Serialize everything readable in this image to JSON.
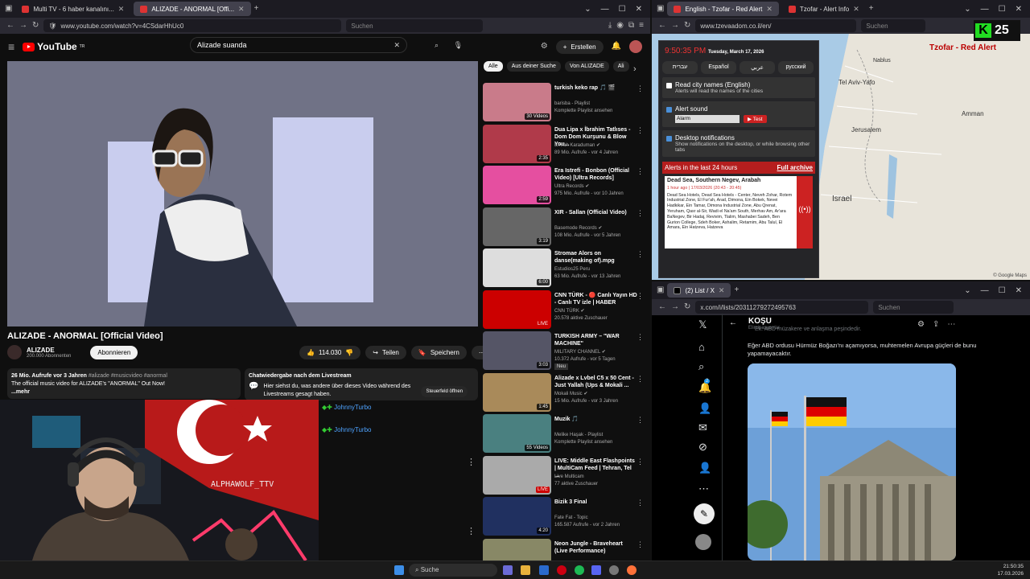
{
  "yt_window": {
    "tabs": [
      {
        "label": "Multi TV - 6 haber kanalını..."
      },
      {
        "label": "ALIZADE - ANORMAL [Offi..."
      }
    ],
    "url": "www.youtube.com/watch?v=4CSdarHhUc0",
    "search_ph": "Suchen",
    "logo": "YouTube",
    "logo_sup": "TR",
    "search_query": "Alizade suanda",
    "create_label": "Erstellen",
    "video_title": "ALIZADE - ANORMAL [Official Video]",
    "channel": "ALIZADE",
    "subs": "200.000 Abonnenten",
    "subscribe": "Abonnieren",
    "likes": "114.030",
    "share": "Teilen",
    "save": "Speichern",
    "desc_meta": "26 Mio. Aufrufe  vor 3 Jahren",
    "desc_tags": " #alizade #musicvideo #anormal",
    "desc_text": "The official music video for ALIZADE's \"ANORMAL\" Out Now!",
    "desc_more": "...mehr",
    "chat_title": "Chatwiedergabe nach dem Livestream",
    "chat_text": "Hier siehst du, was andere über dieses Video während des Livestreams gesagt haben.",
    "chat_btn": "Steuerfeld öffnen",
    "chips": [
      "Alle",
      "Aus deiner Suche",
      "Von ALIZADE",
      "Ali"
    ],
    "recs": [
      {
        "title": "turkish keko rap 🎵 🎬",
        "s1": "barisba - Playlist",
        "s2": "Komplette Playlist ansehen",
        "dur": "30 Videos",
        "col": "#c97b8a"
      },
      {
        "title": "Dua Lipa x İbrahim Tatlıses - Dom Dom Kurşunu & Blow You...",
        "s1": "Emrah Karaduman ✔",
        "s2": "89 Mio. Aufrufe - vor 4 Jahren",
        "dur": "2:35",
        "col": "#b03a4a"
      },
      {
        "title": "Era Istrefi - Bonbon (Official Video) [Ultra Records]",
        "s1": "Ultra Records ✔",
        "s2": "975 Mio. Aufrufe - vor 10 Jahren",
        "dur": "2:59",
        "col": "#e54fa0"
      },
      {
        "title": "XIR - Sallan (Official Video)",
        "s1": "Basemode Records ✔",
        "s2": "108 Mio. Aufrufe - vor 5 Jahren",
        "dur": "3:19",
        "col": "#666"
      },
      {
        "title": "Stromae  Alors on danse(making of).mpg",
        "s1": "Estudios25 Peru",
        "s2": "63 Mio. Aufrufe - vor 13 Jahren",
        "dur": "6:00",
        "col": "#ddd"
      },
      {
        "title": "CNN TÜRK - 🔴 Canlı Yayın HD - Canlı TV izle | HABER",
        "s1": "CNN TÜRK ✔",
        "s2": "20.578 aktive Zuschauer",
        "dur": "LIVE",
        "col": "#c00"
      },
      {
        "title": "TURKISH ARMY – \"WAR MACHINE\"",
        "s1": "MILITARY CHANNEL ✔",
        "s2": "10.372 Aufrufe - vor 5 Tagen",
        "dur": "3:03",
        "col": "#556",
        "badge": "Neu"
      },
      {
        "title": "Alizade x Lvbel C5 x 50 Cent - Just Yallah (Ups & Mokali ...",
        "s1": "Mokali Music ✔",
        "s2": "15 Mio. Aufrufe - vor 3 Jahren",
        "dur": "1:45",
        "col": "#a98a5a"
      },
      {
        "title": "Muzik 🎵",
        "s1": "Melike Haşak - Playlist",
        "s2": "Komplette Playlist ansehen",
        "dur": "55 Videos",
        "col": "#4a8080"
      },
      {
        "title": "LIVE: Middle East Flashpoints | MultiCam Feed | Tehran, Tel ...",
        "s1": "Live Multicam",
        "s2": "77 aktive Zuschauer",
        "dur": "LIVE",
        "col": "#aaa"
      },
      {
        "title": "Bizik 3 Final",
        "s1": "Fate Fat - Topic",
        "s2": "165.587 Aufrufe - vor 2 Jahren",
        "dur": "4:20",
        "col": "#203060"
      },
      {
        "title": "Neon Jungle - Braveheart (Live Performance)",
        "s1": "",
        "s2": "",
        "dur": "",
        "col": "#886"
      }
    ],
    "chat_user": "JohnnyTurbo",
    "cam_text": "ALPHAWOLF_TTV"
  },
  "tz_window": {
    "tabs": [
      {
        "label": "English - Tzofar - Red Alert"
      },
      {
        "label": "Tzofar - Alert Info"
      }
    ],
    "url": "www.tzevaadom.co.il/en/",
    "search_ph": "Suchen",
    "badge": "25",
    "title": "Tzofar - Red Alert",
    "time": "9:50:35 PM",
    "date": "Tuesday, March 17, 2026",
    "langs": [
      "עברית",
      "Español",
      "عربي",
      "русский"
    ],
    "opt1": "Read city names (English)",
    "opt1_sub": "Alerts will read the names of the cities",
    "opt2": "Alert sound",
    "sound": "Alarm",
    "test": "Test",
    "opt3": "Desktop notifications",
    "opt3_sub": "Show notifications on the desktop, or while browsing other tabs",
    "alerts_title": "Alerts in the last 24 hours",
    "archive": "Full archive",
    "alert_place": "Dead Sea, Southern Negev, Arabah",
    "alert_time": "1 hour ago | 17/03/2026 (20:43 - 20:45)",
    "alert_body": "Dead Sea Hotels, Dead Sea Hotels - Center, Neveh Zohar, Rotem Industrial Zone, El Fur'ah, Arad, Dimona, Ein Bokek, Nevei Hadkikar, Ein Tamar, Dimona Industrial Zone, Abu Qrenat, Yeruham, Qasr al-Sir, Wadi el Na'am South, Merhav Am, Ar'ara BaNegev, Bir Hadaj, Revivim, Tlalim, Mashabei Sadeh, Ben Gurion College, Sdeh Boker, Ashalim, Retamim, Abu Talul, El Amara, Ein Hatzeva, Hatzeva",
    "map_labels": [
      "Tel Aviv-Yafo",
      "Jerusalem",
      "Israel",
      "Amman",
      "Nablus"
    ],
    "google": "© Google Maps"
  },
  "x_window": {
    "tab": "(2) List / X",
    "url": "x.com/i/lists/20311279272495763",
    "search_ph": "Suchen",
    "header": "KOŞU",
    "header_sub": "Eliminasyonlar",
    "pre_text": "Ek: ABD müzakere ve anlaşma peşindedir.",
    "post_text": "Eğer ABD ordusu Hürmüz Boğazı'nı açamıyorsa, muhtemelen Avrupa güçleri de bunu yapamayacaktır.",
    "notif_count": "2"
  },
  "taskbar": {
    "search": "Suche",
    "time": "21:50:35",
    "date": "17.03.2026"
  }
}
